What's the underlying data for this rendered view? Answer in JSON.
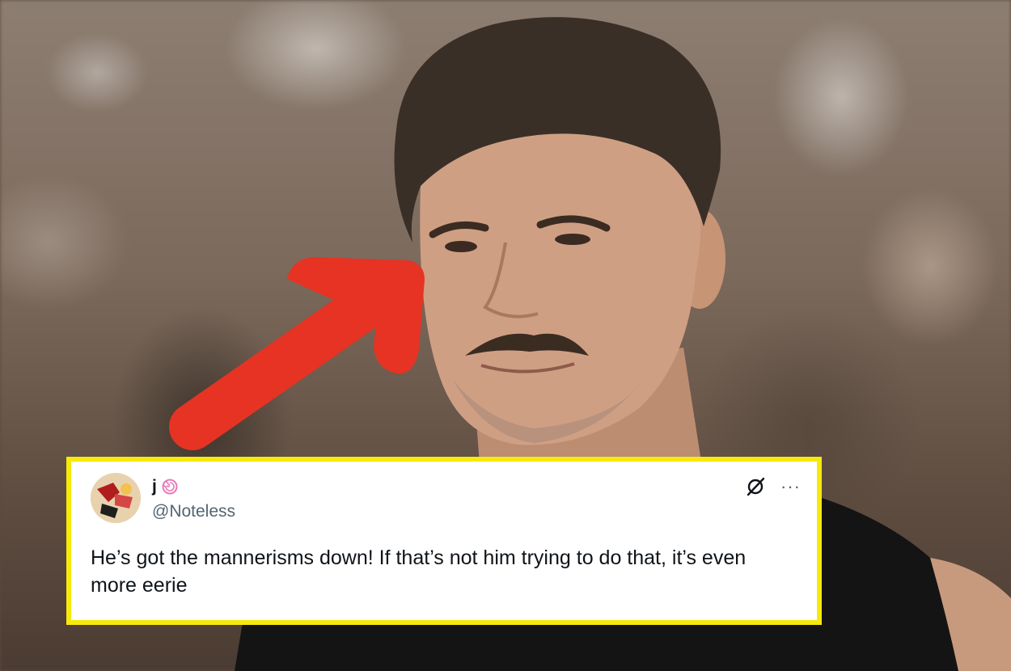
{
  "photo": {
    "description_icon": "person-portrait",
    "arrow_color": "#e63323"
  },
  "tweet": {
    "display_name": "j",
    "name_emoji_icon": "spiral-swirl-icon",
    "handle": "@Noteless",
    "text": "He’s got the mannerisms down! If that’s not him trying to do that, it’s even more eerie",
    "border_color": "#f6e90c",
    "action_icons": [
      "grok-icon",
      "more-icon"
    ],
    "more_label": "···"
  }
}
